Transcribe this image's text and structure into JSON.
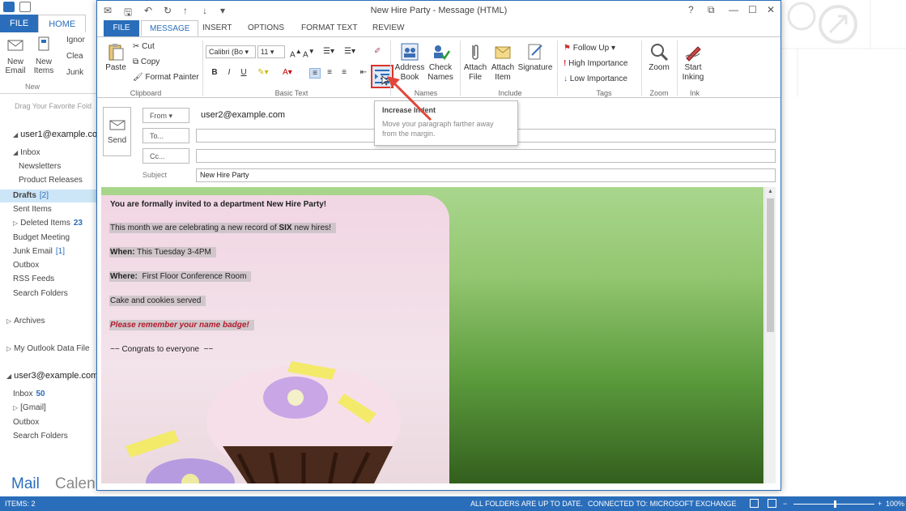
{
  "outlook": {
    "tabs": [
      "FILE",
      "HOME"
    ],
    "ribbon": {
      "new_email": "New Email",
      "new_items": "New Items",
      "ignore": "Ignor",
      "clean": "Clea",
      "junk": "Junk",
      "group_new": "New"
    },
    "favorites_hint": "Drag Your Favorite Fold",
    "account1": "user1@example.com",
    "folders1": [
      {
        "label": "Inbox",
        "count": ""
      },
      {
        "label": "Newsletters",
        "count": ""
      },
      {
        "label": "Product Releases",
        "count": ""
      },
      {
        "label": "Drafts",
        "count": "[2]"
      },
      {
        "label": "Sent Items",
        "count": ""
      },
      {
        "label": "Deleted Items",
        "count": "23"
      },
      {
        "label": "Budget Meeting",
        "count": ""
      },
      {
        "label": "Junk Email",
        "count": "[1]"
      },
      {
        "label": "Outbox",
        "count": ""
      },
      {
        "label": "RSS Feeds",
        "count": ""
      },
      {
        "label": "Search Folders",
        "count": ""
      }
    ],
    "archives": "Archives",
    "data_file": "My Outlook Data File",
    "account2": "user3@example.com",
    "folders2": [
      {
        "label": "Inbox",
        "count": "50"
      },
      {
        "label": "[Gmail]",
        "count": ""
      },
      {
        "label": "Outbox",
        "count": ""
      },
      {
        "label": "Search Folders",
        "count": ""
      }
    ],
    "bottom_nav": {
      "mail": "Mail",
      "calendar": "Calen"
    },
    "status": {
      "items": "ITEMS: 2",
      "sync": "ALL FOLDERS ARE UP TO DATE.",
      "connection": "CONNECTED TO: MICROSOFT EXCHANGE",
      "zoom": "100%"
    }
  },
  "message": {
    "title": "New Hire Party - Message (HTML)",
    "tabs": [
      "FILE",
      "MESSAGE",
      "INSERT",
      "OPTIONS",
      "FORMAT TEXT",
      "REVIEW"
    ],
    "active_tab": "MESSAGE",
    "window_controls": {
      "help": "?",
      "restore": "⧉",
      "minimize": "—",
      "maximize": "☐",
      "close": "✕"
    },
    "ribbon": {
      "clipboard": {
        "paste": "Paste",
        "cut": "Cut",
        "copy": "Copy",
        "format_painter": "Format Painter",
        "label": "Clipboard"
      },
      "basic_text": {
        "font": "Calibri (Bo",
        "size": "11",
        "bold": "B",
        "italic": "I",
        "underline": "U",
        "label": "Basic Text"
      },
      "names": {
        "address_book": "Address Book",
        "check_names": "Check Names",
        "label": "Names"
      },
      "include": {
        "attach_file": "Attach File",
        "attach_item": "Attach Item",
        "signature": "Signature",
        "label": "Include"
      },
      "tags": {
        "follow_up": "Follow Up",
        "high": "High Importance",
        "low": "Low Importance",
        "label": "Tags"
      },
      "zoom": {
        "zoom": "Zoom",
        "label": "Zoom"
      },
      "ink": {
        "start_inking": "Start Inking",
        "label": "Ink"
      }
    },
    "tooltip": {
      "title": "Increase Indent",
      "desc": "Move your paragraph farther away from the margin."
    },
    "header": {
      "send": "Send",
      "from_label": "From",
      "from_value": "user2@example.com",
      "to_label": "To...",
      "cc_label": "Cc...",
      "subject_label": "Subject",
      "subject_value": "New Hire Party"
    },
    "body": {
      "l1": "You are formally invited to a department New Hire Party!",
      "l2a": "This month we are celebrating a new record of ",
      "l2b": "SIX",
      "l2c": " new hires!",
      "l3a": "When:",
      "l3b": " This Tuesday 3-4PM",
      "l4a": "Where:",
      "l4b": "  First Floor Conference Room",
      "l5": "Cake and cookies served",
      "l6": "Please remember your name badge!",
      "l7": "~~ Congrats to everyone  ~~"
    }
  }
}
